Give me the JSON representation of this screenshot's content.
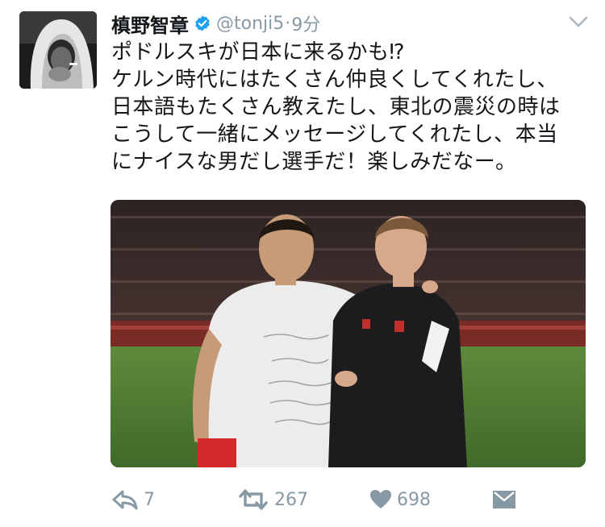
{
  "tweet": {
    "name": "槙野智章",
    "handle": "@tonji5",
    "separator": "·",
    "time": "9分",
    "lines": [
      "ポドルスキが日本に来るかも⁉",
      "ケルン時代にはたくさん仲良くしてくれたし、",
      "日本語もたくさん教えたし、東北の震災の時は",
      "こうして一緒にメッセージしてくれたし、本当",
      "にナイスな男だし選手だ！楽しみだなー。"
    ]
  },
  "actions": {
    "reply_count": "7",
    "retweet_count": "267",
    "like_count": "698"
  },
  "icons": {
    "verified": "verified-badge-icon",
    "caret": "chevron-down-icon",
    "reply": "reply-icon",
    "retweet": "retweet-icon",
    "like": "heart-icon",
    "dm": "direct-message-icon"
  },
  "colors": {
    "icon_gray": "#8899a6",
    "verified_blue": "#1da1f2",
    "text": "#14171a"
  }
}
